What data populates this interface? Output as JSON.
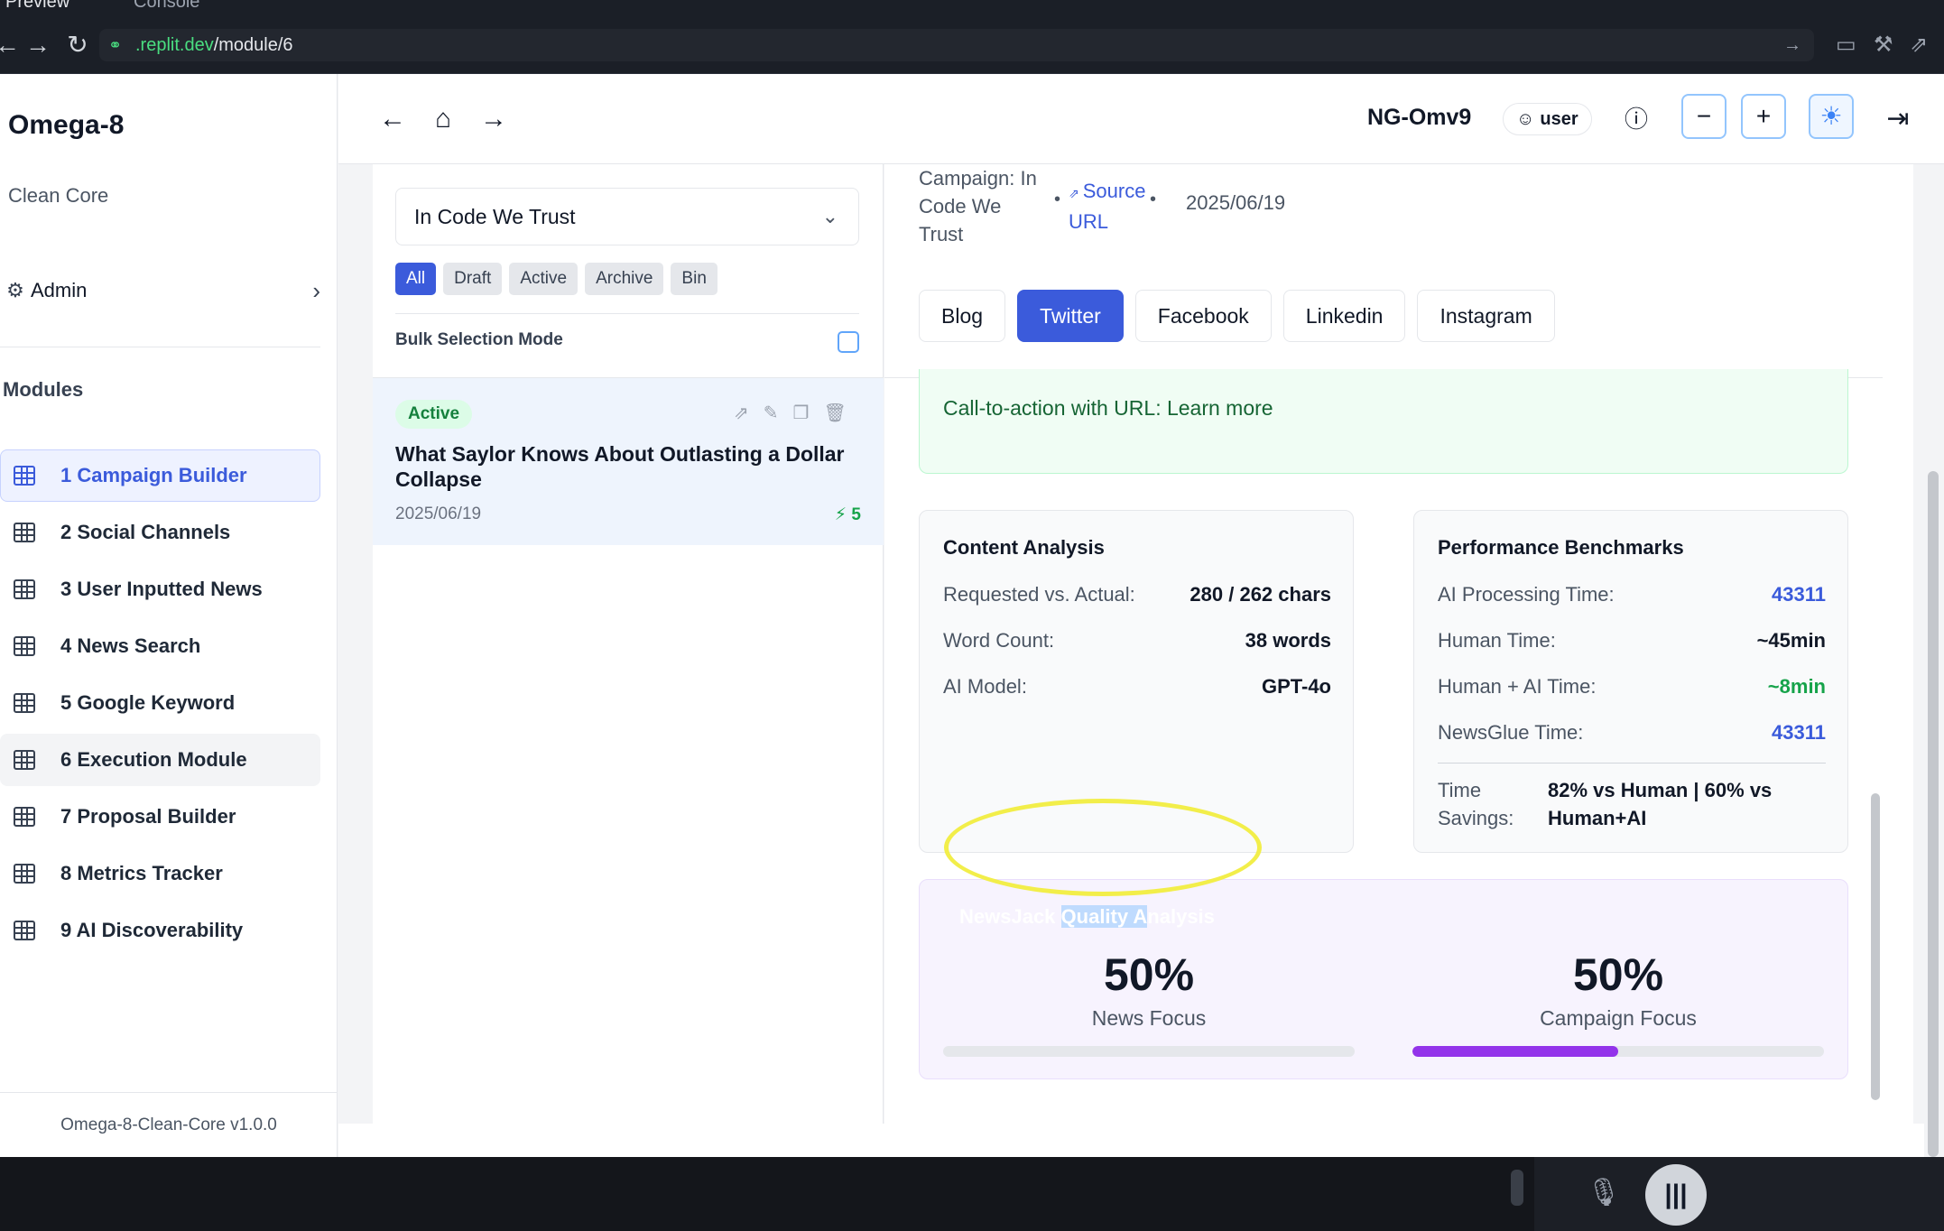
{
  "browser": {
    "tabs": [
      "Preview",
      "Console"
    ],
    "url_host": ".replit.dev",
    "url_path": "/module/6"
  },
  "sidebar": {
    "brand": "Omega-8",
    "subtitle": "Clean Core",
    "admin_label": "Admin",
    "modules_heading": "Modules",
    "items": [
      {
        "label": "1 Campaign Builder",
        "state": "selected"
      },
      {
        "label": "2 Social Channels",
        "state": ""
      },
      {
        "label": "3 User Inputted News",
        "state": ""
      },
      {
        "label": "4 News Search",
        "state": ""
      },
      {
        "label": "5 Google Keyword",
        "state": ""
      },
      {
        "label": "6 Execution Module",
        "state": "hover"
      },
      {
        "label": "7 Proposal Builder",
        "state": ""
      },
      {
        "label": "8 Metrics Tracker",
        "state": ""
      },
      {
        "label": "9 AI Discoverability",
        "state": ""
      }
    ],
    "footer": "Omega-8-Clean-Core v1.0.0"
  },
  "header": {
    "org": "NG-Omv9",
    "user_label": "user"
  },
  "list": {
    "campaign_selected": "In Code We Trust",
    "filters": [
      "All",
      "Draft",
      "Active",
      "Archive",
      "Bin"
    ],
    "active_filter": "All",
    "bulk_label": "Bulk Selection Mode",
    "card": {
      "status": "Active",
      "title": "What Saylor Knows About Outlasting a Dollar Collapse",
      "date": "2025/06/19",
      "score": "5"
    }
  },
  "detail": {
    "campaign_text": "Campaign: In Code We Trust",
    "source_link": "Source URL",
    "date": "2025/06/19",
    "tabs": [
      "Blog",
      "Twitter",
      "Facebook",
      "Linkedin",
      "Instagram"
    ],
    "active_tab": "Twitter",
    "cta_text": "Call-to-action with URL: Learn more",
    "content_analysis": {
      "title": "Content Analysis",
      "rows": [
        {
          "label": "Requested vs. Actual:",
          "value": "280 / 262 chars"
        },
        {
          "label": "Word Count:",
          "value": "38 words"
        },
        {
          "label": "AI Model:",
          "value": "GPT-4o"
        }
      ]
    },
    "performance": {
      "title": "Performance Benchmarks",
      "rows": [
        {
          "label": "AI Processing Time:",
          "value": "43311",
          "tone": "blue"
        },
        {
          "label": "Human Time:",
          "value": "~45min",
          "tone": ""
        },
        {
          "label": "Human + AI Time:",
          "value": "~8min",
          "tone": "green"
        },
        {
          "label": "NewsGlue Time:",
          "value": "43311",
          "tone": "blue"
        }
      ],
      "savings_label": "Time Savings:",
      "savings_value": "82% vs Human | 60% vs Human+AI"
    },
    "quality": {
      "title_pre": "NewsJack ",
      "title_hl": "Quality A",
      "title_post": "nalysis",
      "news_pct": "50%",
      "news_label": "News Focus",
      "news_fraction": 0.0,
      "campaign_pct": "50%",
      "campaign_label": "Campaign Focus",
      "campaign_fraction": 0.5
    }
  },
  "colors": {
    "accent": "#3b5bdb",
    "active_green": "#15803d",
    "campaign_bar": "#9333ea",
    "annotation": "#f2ee4a"
  }
}
